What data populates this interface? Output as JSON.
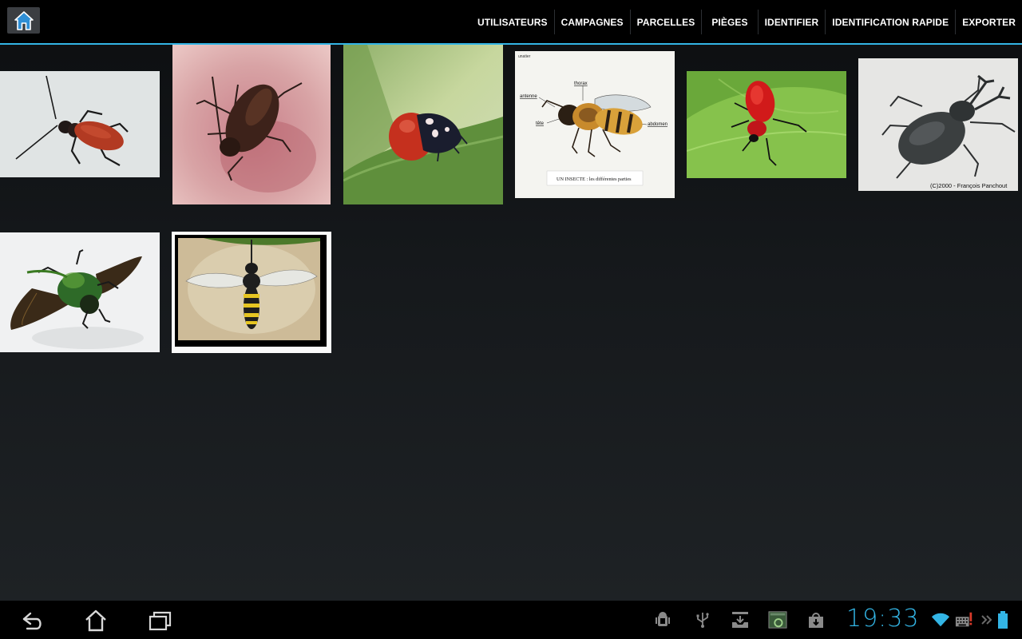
{
  "action_bar": {
    "home_icon": "home-icon",
    "menu": [
      {
        "label": "UTILISATEURS"
      },
      {
        "label": "CAMPAGNES"
      },
      {
        "label": "PARCELLES"
      },
      {
        "label": "PIÈGES"
      },
      {
        "label": "IDENTIFIER"
      },
      {
        "label": "IDENTIFICATION RAPIDE"
      },
      {
        "label": "EXPORTER"
      }
    ],
    "accent_color": "#33b5e5"
  },
  "gallery": {
    "images": [
      {
        "subject": "red-longhorn-beetle"
      },
      {
        "subject": "brown-beetle-on-hand"
      },
      {
        "subject": "ladybug-on-leaf"
      },
      {
        "subject": "bee-anatomy-diagram",
        "diagram_labels": {
          "corner": "unatier",
          "thorax": "thorax",
          "antenne": "antenne",
          "tete": "tête",
          "abdomen": "abdomen",
          "caption": "UN INSECTE : les différentes parties"
        }
      },
      {
        "subject": "red-lily-beetle-on-leaf"
      },
      {
        "subject": "stag-beetle",
        "credit": "(C)2000 - François Panchout"
      },
      {
        "subject": "green-flying-beetle"
      },
      {
        "subject": "wasp-framed"
      }
    ]
  },
  "system_bar": {
    "nav": [
      "back-icon",
      "home-icon",
      "recent-apps-icon"
    ],
    "status_icons": [
      "android-debug-icon",
      "usb-icon",
      "download-tray-icon",
      "screenshot-icon",
      "store-download-icon"
    ],
    "clock": "19:33",
    "right_icons": [
      "wifi-icon",
      "keyboard-alert-icon",
      "chevron-more-icon",
      "battery-icon"
    ]
  }
}
